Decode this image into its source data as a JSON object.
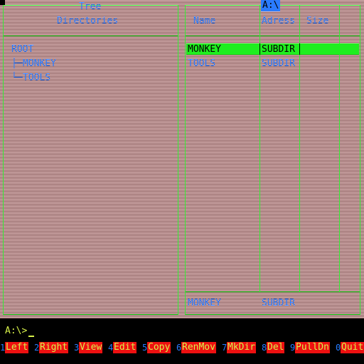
{
  "colors": {
    "frame_green": "#33ee33",
    "text_blue": "#2a7bff",
    "highlight_green": "#1fee1f",
    "prompt_yellow": "#d8f24a",
    "fkey_red": "#ee1010"
  },
  "left_panel": {
    "title_line1": "Tree",
    "title_line2": "Directories",
    "tree": {
      "root": "ROOT",
      "children": [
        {
          "prefix": "├─",
          "name": "MONKEY"
        },
        {
          "prefix": "└─",
          "name": "TOOLS"
        }
      ]
    }
  },
  "right_panel": {
    "drive": "A:\\",
    "columns": [
      "Name",
      "Adress",
      "Size"
    ],
    "rows": [
      {
        "name": "MONKEY",
        "address": "SUBDIR",
        "size": "",
        "selected": true
      },
      {
        "name": "TOOLS",
        "address": "SUBDIR",
        "size": "",
        "selected": false
      }
    ],
    "status": {
      "name": "MONKEY",
      "address": "SUBDIR"
    }
  },
  "prompt": "A:\\>",
  "function_keys": [
    {
      "num": "1",
      "label": "Left"
    },
    {
      "num": "2",
      "label": "Right"
    },
    {
      "num": "3",
      "label": "View"
    },
    {
      "num": "4",
      "label": "Edit"
    },
    {
      "num": "5",
      "label": "Copy"
    },
    {
      "num": "6",
      "label": "RenMov"
    },
    {
      "num": "7",
      "label": "MkDir"
    },
    {
      "num": "8",
      "label": "Del"
    },
    {
      "num": "9",
      "label": "PullDn"
    },
    {
      "num": "0",
      "label": "Quit"
    }
  ]
}
